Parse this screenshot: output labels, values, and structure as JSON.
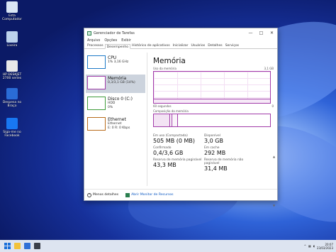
{
  "desktop": {
    "icons": [
      {
        "label": "Esta Computador",
        "color": "#d9e6f5"
      },
      {
        "label": "Lixeira",
        "color": "#bcd2ec"
      },
      {
        "label": "HP DESKJET 2700 series",
        "color": "#e9e9e9"
      },
      {
        "label": "Despesa no Braço",
        "color": "#2a6cd6"
      },
      {
        "label": "Siga-me no Facebook",
        "color": "#1877f2"
      }
    ]
  },
  "window": {
    "title": "Gerenciador de Tarefas",
    "controls": {
      "minimize": "—",
      "maximize": "□",
      "close": "✕"
    },
    "menu": [
      "Arquivo",
      "Opções",
      "Exibir"
    ],
    "tabs": [
      "Processos",
      "Desempenho",
      "Histórico de aplicativos",
      "Inicializar",
      "Usuários",
      "Detalhes",
      "Serviços"
    ],
    "active_tab": "Desempenho"
  },
  "resources": [
    {
      "name": "CPU",
      "sub1": "1% 3,16 GHz",
      "sub2": "",
      "color": "#1e7ac7"
    },
    {
      "name": "Memória",
      "sub1": "0,3/3,1 GB (14%)",
      "sub2": "",
      "color": "#a13ba9"
    },
    {
      "name": "Disco 0 (C:)",
      "sub1": "HDD",
      "sub2": "0%",
      "color": "#3f9b3a"
    },
    {
      "name": "Ethernet",
      "sub1": "Ethernet",
      "sub2": "E: 0 R: 0 Kbps",
      "color": "#b86b1a"
    }
  ],
  "memory": {
    "title": "Memória",
    "graph_label": "Uso da memória",
    "graph_max": "3,1 GB",
    "time_left": "60 segundos",
    "time_right": "0",
    "graph_level": 0.14,
    "composition_label": "Composição da memória",
    "composition": {
      "used": 0.14,
      "modified": 0.02,
      "standby": 0.05
    },
    "stats": [
      {
        "label": "Em uso (Compactada)",
        "value": "505 MB (0 MB)"
      },
      {
        "label": "Disponível",
        "value": "3,0 GB"
      },
      {
        "label": "Confirmado",
        "value": "0,4/3,6 GB"
      },
      {
        "label": "Em cache",
        "value": "292 MB"
      },
      {
        "label": "Reserva de memória paginável",
        "value": "43,3 MB"
      },
      {
        "label": "Reserva de memória não paginável",
        "value": "31,4 MB"
      }
    ]
  },
  "footer": {
    "less_details": "Menos detalhes",
    "resource_monitor": "Abrir Monitor de Recursos"
  },
  "taskbar": {
    "icons": [
      {
        "name": "file-explorer-icon",
        "color": "#f2c23a"
      },
      {
        "name": "store-icon",
        "color": "#2f6fd6"
      },
      {
        "name": "task-manager-icon",
        "color": "#3a3f4a"
      }
    ],
    "tray_chevron": "^",
    "clock_time": "20:07",
    "clock_date": "23/03/2023"
  }
}
